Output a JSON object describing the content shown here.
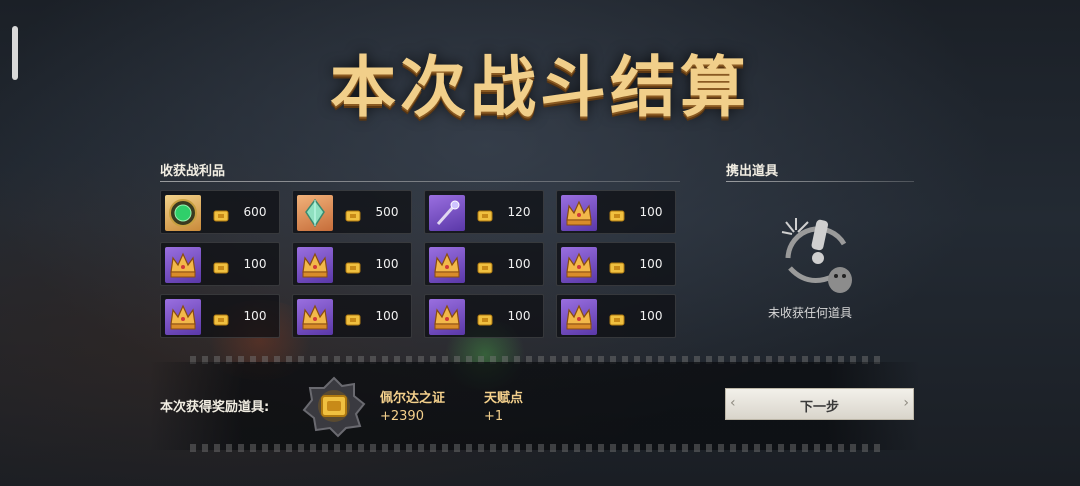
{
  "title": "本次战斗结算",
  "loot": {
    "label": "收获战利品",
    "items": [
      {
        "icon": "emerald-gem-icon",
        "frame": "gold",
        "quantity": "600"
      },
      {
        "icon": "green-crystal-icon",
        "frame": "orange",
        "quantity": "500"
      },
      {
        "icon": "staff-icon",
        "frame": "purple",
        "quantity": "120"
      },
      {
        "icon": "crown-icon",
        "frame": "purple",
        "quantity": "100"
      },
      {
        "icon": "crown-icon",
        "frame": "purple",
        "quantity": "100"
      },
      {
        "icon": "crown-icon",
        "frame": "purple",
        "quantity": "100"
      },
      {
        "icon": "crown-icon",
        "frame": "purple",
        "quantity": "100"
      },
      {
        "icon": "crown-icon",
        "frame": "purple",
        "quantity": "100"
      },
      {
        "icon": "crown-icon",
        "frame": "purple",
        "quantity": "100"
      },
      {
        "icon": "crown-icon",
        "frame": "purple",
        "quantity": "100"
      },
      {
        "icon": "crown-icon",
        "frame": "purple",
        "quantity": "100"
      },
      {
        "icon": "crown-icon",
        "frame": "purple",
        "quantity": "100"
      }
    ]
  },
  "carried_out": {
    "label": "携出道具",
    "empty_text": "未收获任何道具"
  },
  "rewards": {
    "label": "本次获得奖励道具:",
    "medal_name": "佩尔达之证",
    "medal_value": "+2390",
    "talent_name": "天赋点",
    "talent_value": "+1"
  },
  "next_button": {
    "label": "下一步"
  },
  "colors": {
    "gold_text": "#f4d08c",
    "title_gold": "#f1cf8a",
    "purple_frame": "#7a52c8"
  }
}
